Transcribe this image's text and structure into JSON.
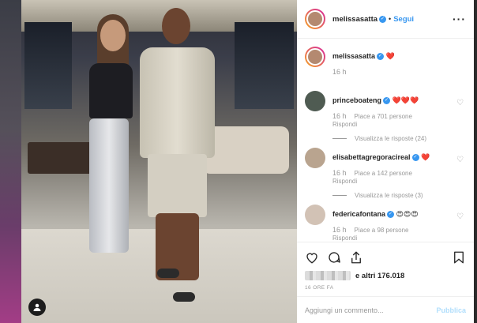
{
  "post": {
    "username": "melissasatta",
    "follow_label": "Segui",
    "more_icon": "more-options-icon"
  },
  "caption": {
    "username": "melissasatta",
    "text": "❤️",
    "time": "16 h"
  },
  "comments": [
    {
      "username": "princeboateng",
      "text": "❤️❤️❤️",
      "time": "16 h",
      "likes": "Piace a 701 persone",
      "reply": "Rispondi",
      "replies": "Visualizza le risposte (24)",
      "avatar_color": "#4f5b52"
    },
    {
      "username": "elisabettagregoracireal",
      "text": "❤️",
      "time": "16 h",
      "likes": "Piace a 142 persone",
      "reply": "Rispondi",
      "replies": "Visualizza le risposte (3)",
      "avatar_color": "#b9a48f"
    },
    {
      "username": "federicafontana",
      "text": "😍😍😍",
      "time": "16 h",
      "likes": "Piace a 98 persone",
      "reply": "Rispondi",
      "avatar_color": "#d2c2b5"
    }
  ],
  "footer": {
    "likes_suffix": "e altri 176.018",
    "time_ago": "16 ORE FA",
    "comment_placeholder": "Aggiungi un commento...",
    "publish_label": "Pubblica"
  },
  "colors": {
    "accent": "#3897f0",
    "heart": "#ed4956",
    "muted": "#999999"
  }
}
